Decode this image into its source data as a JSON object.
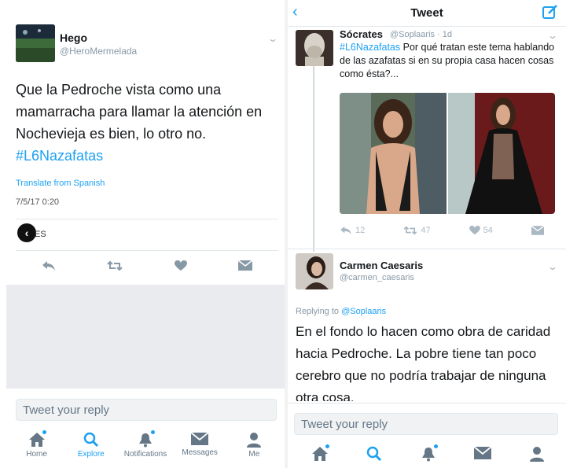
{
  "left": {
    "tweet": {
      "name": "Hego",
      "handle": "@HeroMermelada",
      "text_before": "Que la Pedroche vista como una mamarracha para llamar la atención en Nochevieja es bien, lo otro no. ",
      "hashtag": "#L6Nazafatas",
      "translate": "Translate from Spanish",
      "timestamp": "7/5/17 0:20",
      "likes_label": "ES"
    },
    "reply_placeholder": "Tweet your reply",
    "tabs": [
      {
        "label": "Home",
        "icon": "home-icon"
      },
      {
        "label": "Explore",
        "icon": "search-icon"
      },
      {
        "label": "Notifications",
        "icon": "bell-icon"
      },
      {
        "label": "Messages",
        "icon": "envelope-icon"
      },
      {
        "label": "Me",
        "icon": "person-icon"
      }
    ]
  },
  "right": {
    "header": {
      "title": "Tweet"
    },
    "parent": {
      "name": "Sócrates",
      "handle_time": "@Soplaaris · 1d",
      "hashtag": "#L6Nazafatas",
      "text": " Por qué tratan este tema hablando de las azafatas si en su propia casa hacen cosas como ésta?...",
      "replies": "12",
      "retweets": "47",
      "likes": "54"
    },
    "reply": {
      "name": "Carmen Caesaris",
      "handle": "@carmen_caesaris",
      "replying_prefix": "Replying to ",
      "replying_to": "@Soplaaris",
      "text": "En el fondo lo hacen como obra de caridad hacia Pedroche. La pobre tiene tan poco cerebro que no podría trabajar de ninguna otra cosa."
    },
    "reply_placeholder": "Tweet your reply"
  },
  "colors": {
    "accent": "#1da1f2",
    "muted": "#aab8c2"
  }
}
